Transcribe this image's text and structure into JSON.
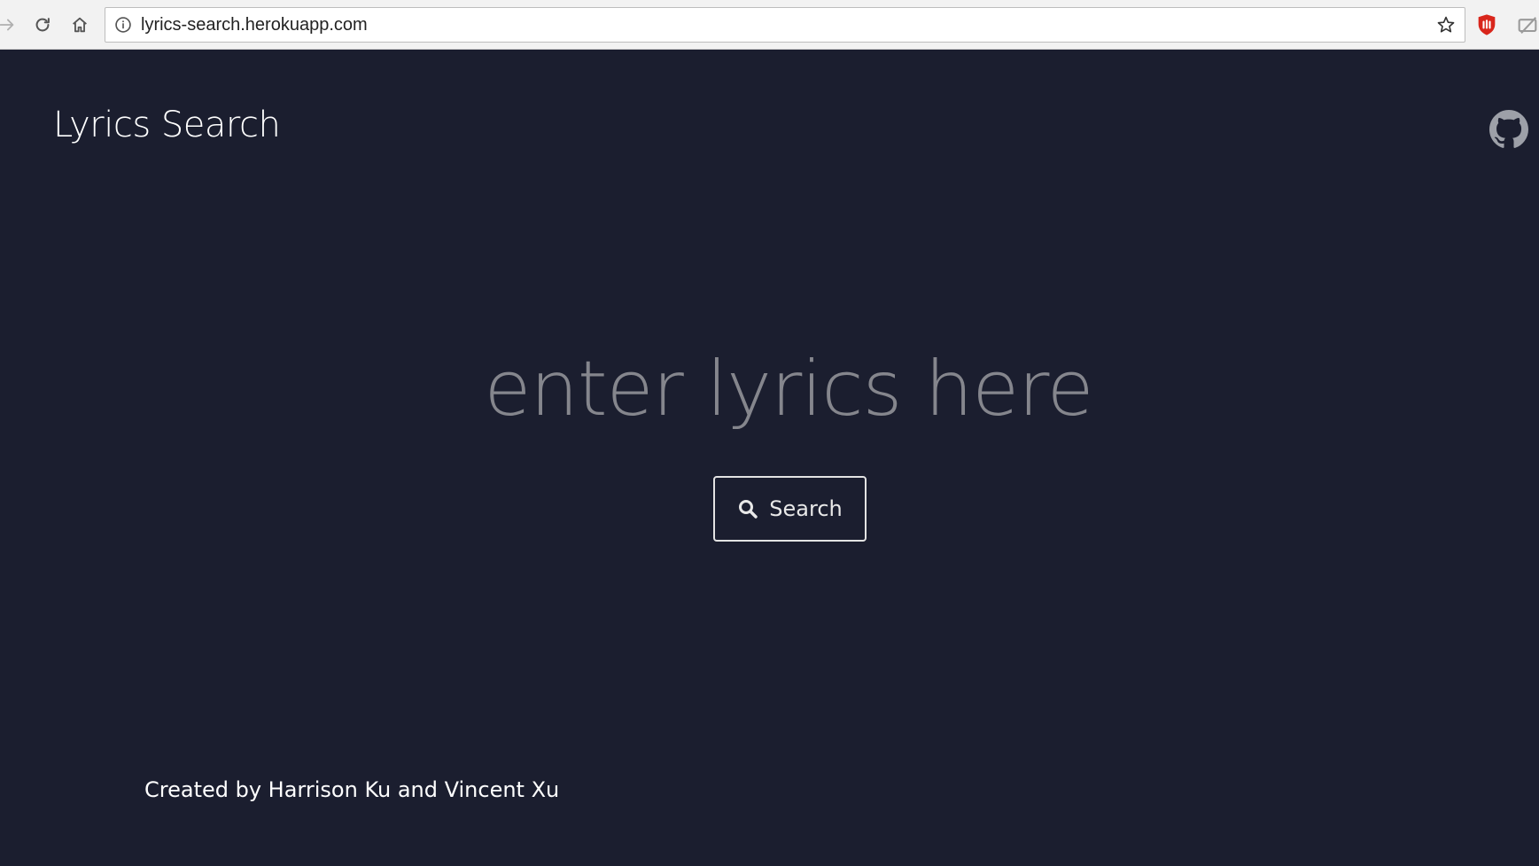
{
  "browser": {
    "url": "lyrics-search.herokuapp.com"
  },
  "header": {
    "title": "Lyrics Search"
  },
  "search": {
    "placeholder": "enter lyrics here",
    "button_label": "Search"
  },
  "footer": {
    "credit": "Created by Harrison Ku and Vincent Xu"
  },
  "icons": {
    "back": "back-arrow-icon",
    "reload": "reload-icon",
    "home": "home-icon",
    "site_info": "info-icon",
    "bookmark": "star-icon",
    "extension_1": "ublock-icon",
    "extension_2": "extension-icon",
    "github": "github-icon",
    "search": "search-icon"
  },
  "colors": {
    "page_background": "#1b1e2f",
    "title_text": "#ffffff",
    "placeholder_text": "#85868d",
    "button_border": "#e3e3e3",
    "extension_red": "#d9261c"
  }
}
